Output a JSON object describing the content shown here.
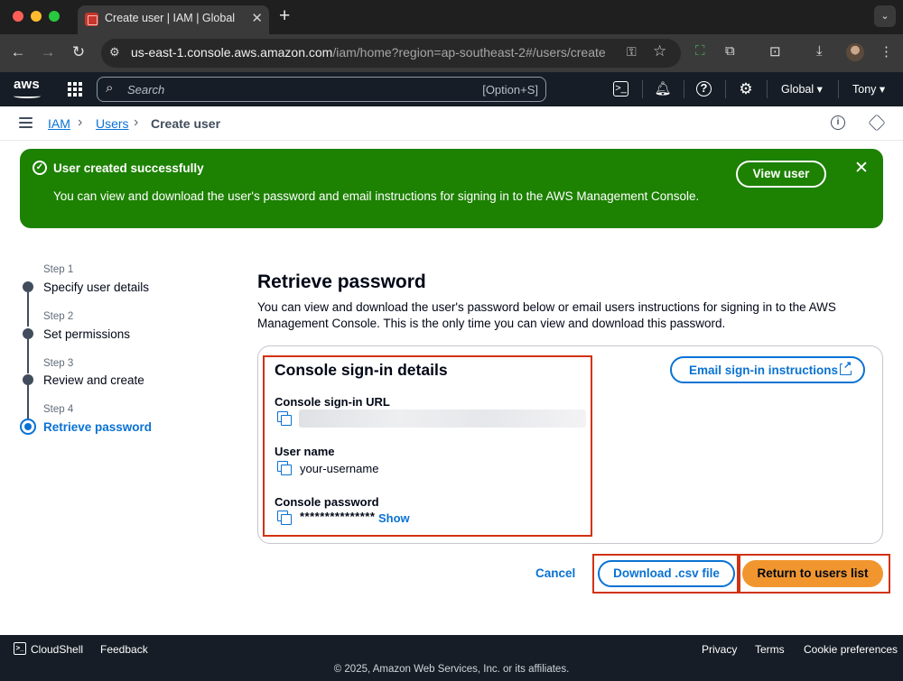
{
  "browser": {
    "tab_title": "Create user | IAM | Global",
    "url_host": "us-east-1.console.aws.amazon.com",
    "url_path": "/iam/home?region=ap-southeast-2#/users/create"
  },
  "aws_nav": {
    "search_placeholder": "Search",
    "search_shortcut": "[Option+S]",
    "region": "Global",
    "user": "Tony"
  },
  "breadcrumb": {
    "items": [
      "IAM",
      "Users",
      "Create user"
    ]
  },
  "flash": {
    "title": "User created successfully",
    "message": "You can view and download the user's password and email instructions for signing in to the AWS Management Console.",
    "action_label": "View user"
  },
  "steps": [
    {
      "number": "Step 1",
      "title": "Specify user details"
    },
    {
      "number": "Step 2",
      "title": "Set permissions"
    },
    {
      "number": "Step 3",
      "title": "Review and create"
    },
    {
      "number": "Step 4",
      "title": "Retrieve password"
    }
  ],
  "main": {
    "title": "Retrieve password",
    "description": "You can view and download the user's password below or email users instructions for signing in to the AWS Management Console. This is the only time you can view and download this password.",
    "card_title": "Console sign-in details",
    "email_button": "Email sign-in instructions",
    "fields": {
      "url_label": "Console sign-in URL",
      "username_label": "User name",
      "username_value": "your-username",
      "password_label": "Console password",
      "password_value": "***************",
      "show_label": "Show"
    }
  },
  "actions": {
    "cancel": "Cancel",
    "download": "Download .csv file",
    "return": "Return to users list"
  },
  "footer": {
    "cloudshell": "CloudShell",
    "feedback": "Feedback",
    "privacy": "Privacy",
    "terms": "Terms",
    "cookies": "Cookie preferences",
    "copyright": "© 2025, Amazon Web Services, Inc. or its affiliates."
  },
  "colors": {
    "success_green": "#1d8102",
    "link_blue": "#0972d3",
    "primary_orange": "#f1962f",
    "highlight_red": "#d13212",
    "nav_dark": "#161d26"
  }
}
